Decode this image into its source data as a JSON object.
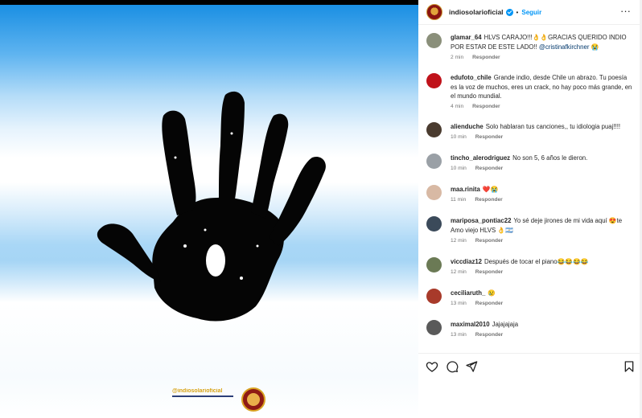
{
  "media": {
    "handle_text": "@indiosolarioficial",
    "logo": "indio-solari-seal",
    "image": "black-handprint-on-argentine-flag"
  },
  "header": {
    "username": "indiosolarioficial",
    "verified_icon": "verified-badge-icon",
    "separator": "•",
    "follow_label": "Seguir",
    "more_icon": "more-horizontal-icon",
    "accent_color": "#0095f6"
  },
  "comments": [
    {
      "user": "glamar_64",
      "text": "HLVS CARAJO!!!👌👌GRACIAS QUERIDO INDIO POR ESTAR DE ESTE LADO!! ",
      "mention": "@cristinafkirchner",
      "suffix": " 😭",
      "time": "2 min",
      "reply": "Responder"
    },
    {
      "user": "edufoto_chile",
      "text": "Grande indio, desde Chile un abrazo. Tu poesía es la voz de muchos, eres un crack, no hay poco más grande, en el mundo mundial.",
      "time": "4 min",
      "reply": "Responder"
    },
    {
      "user": "alienduche",
      "text": "Solo hablaran tus canciones,, tu idiologia puaj!!!!",
      "time": "10 min",
      "reply": "Responder"
    },
    {
      "user": "tincho_alerodriguez",
      "text": "No son 5, 6 años le dieron.",
      "time": "10 min",
      "reply": "Responder"
    },
    {
      "user": "maa.rinita",
      "text": "❤️😭",
      "time": "11 min",
      "reply": "Responder"
    },
    {
      "user": "mariposa_pontiac22",
      "text": "Yo sé deje jirones de mi vida aquí 😍te Amo viejo HLVS 👌🇦🇷",
      "time": "12 min",
      "reply": "Responder"
    },
    {
      "user": "viccdiaz12",
      "text": "Después de tocar el piano😂😂😂😂",
      "time": "12 min",
      "reply": "Responder"
    },
    {
      "user": "ceciliaruth_",
      "text": "😢",
      "time": "13 min",
      "reply": "Responder"
    },
    {
      "user": "maximal2010",
      "text": "Jajajajaja",
      "time": "13 min",
      "reply": "Responder"
    }
  ],
  "actions": {
    "like_icon": "heart-icon",
    "comment_icon": "comment-bubble-icon",
    "share_icon": "paper-plane-icon",
    "save_icon": "bookmark-icon"
  }
}
